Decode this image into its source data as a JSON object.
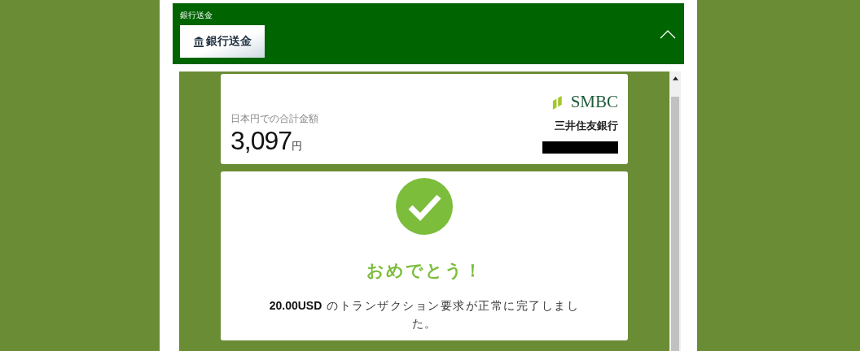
{
  "panel": {
    "title": "銀行送金",
    "method_button": "銀行送金",
    "expanded": true
  },
  "summary": {
    "label": "日本円での合計金額",
    "amount": "3,097",
    "currency": "円",
    "bank_logo": "SMBC",
    "bank_name": "三井住友銀行"
  },
  "result": {
    "heading": "おめでとう！",
    "message": "**20.00USD** のトランザクション要求が正常に完了しました。"
  }
}
